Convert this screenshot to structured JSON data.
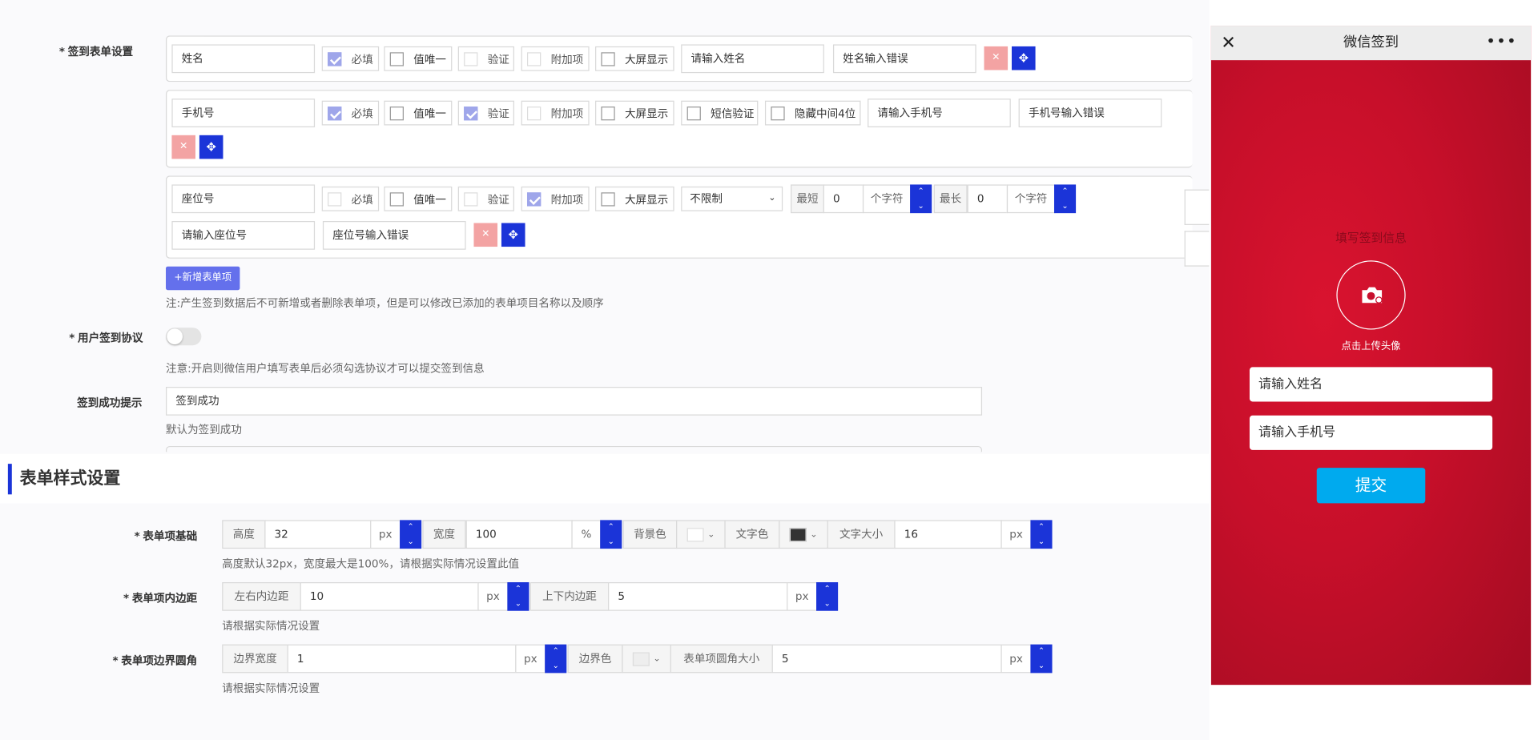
{
  "form_settings": {
    "label": "签到表单设置",
    "rows": [
      {
        "field_name": "姓名",
        "checks": [
          {
            "label": "必填",
            "checked": true,
            "disabled": true
          },
          {
            "label": "值唯一",
            "checked": false,
            "disabled": false
          },
          {
            "label": "验证",
            "checked": false,
            "disabled": true
          },
          {
            "label": "附加项",
            "checked": false,
            "disabled": true
          },
          {
            "label": "大屏显示",
            "checked": false,
            "disabled": false
          }
        ],
        "placeholder": "请输入姓名",
        "error": "姓名输入错误"
      },
      {
        "field_name": "手机号",
        "checks": [
          {
            "label": "必填",
            "checked": true,
            "disabled": true
          },
          {
            "label": "值唯一",
            "checked": false,
            "disabled": false
          },
          {
            "label": "验证",
            "checked": true,
            "disabled": true
          },
          {
            "label": "附加项",
            "checked": false,
            "disabled": true
          },
          {
            "label": "大屏显示",
            "checked": false,
            "disabled": false
          },
          {
            "label": "短信验证",
            "checked": false,
            "disabled": false
          },
          {
            "label": "隐藏中间4位",
            "checked": false,
            "disabled": false
          }
        ],
        "placeholder": "请输入手机号",
        "error": "手机号输入错误"
      },
      {
        "field_name": "座位号",
        "checks": [
          {
            "label": "必填",
            "checked": false,
            "disabled": true
          },
          {
            "label": "值唯一",
            "checked": false,
            "disabled": false
          },
          {
            "label": "验证",
            "checked": false,
            "disabled": true
          },
          {
            "label": "附加项",
            "checked": true,
            "disabled": true
          },
          {
            "label": "大屏显示",
            "checked": false,
            "disabled": false
          }
        ],
        "limit_select": "不限制",
        "min_label": "最短",
        "min_value": "0",
        "max_label": "最长",
        "max_value": "0",
        "unit": "个字符",
        "placeholder": "请输入座位号",
        "error": "座位号输入错误"
      }
    ],
    "add_button": "+新增表单项",
    "note": "注:产生签到数据后不可新增或者删除表单项，但是可以修改已添加的表单项目名称以及顺序"
  },
  "agreement": {
    "label": "用户签到协议",
    "enabled": false,
    "note": "注意:开启则微信用户填写表单后必须勾选协议才可以提交签到信息"
  },
  "success": {
    "label": "签到成功提示",
    "value": "签到成功",
    "hint": "默认为签到成功"
  },
  "style_section": {
    "title": "表单样式设置",
    "base": {
      "label": "表单项基础",
      "height_label": "高度",
      "height_value": "32",
      "height_unit": "px",
      "width_label": "宽度",
      "width_value": "100",
      "width_unit": "%",
      "bg_label": "背景色",
      "bg_color": "#ffffff",
      "text_color_label": "文字色",
      "text_color": "#333333",
      "font_size_label": "文字大小",
      "font_size_value": "16",
      "font_size_unit": "px",
      "hint": "高度默认32px，宽度最大是100%，请根据实际情况设置此值"
    },
    "padding": {
      "label": "表单项内边距",
      "lr_label": "左右内边距",
      "lr_value": "10",
      "lr_unit": "px",
      "tb_label": "上下内边距",
      "tb_value": "5",
      "tb_unit": "px",
      "hint": "请根据实际情况设置"
    },
    "border": {
      "label": "表单项边界圆角",
      "width_label": "边界宽度",
      "width_value": "1",
      "width_unit": "px",
      "color_label": "边界色",
      "border_color": "#eeeeee",
      "radius_label": "表单项圆角大小",
      "radius_value": "5",
      "radius_unit": "px",
      "hint": "请根据实际情况设置"
    }
  },
  "preview": {
    "title": "微信签到",
    "heading": "填写签到信息",
    "avatar_caption": "点击上传头像",
    "inputs": [
      "请输入姓名",
      "请输入手机号"
    ],
    "submit": "提交",
    "brand_color": "#c8102e",
    "button_color": "#00aaee"
  }
}
